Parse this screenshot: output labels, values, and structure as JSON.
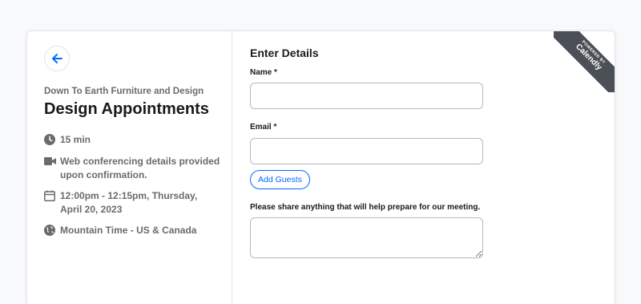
{
  "event": {
    "organization": "Down To Earth Furniture and Design",
    "title": "Design Appointments",
    "duration": "15 min",
    "conferencing": "Web conferencing details provided upon confirmation.",
    "datetime": "12:00pm - 12:15pm, Thursday, April 20, 2023",
    "timezone": "Mountain Time - US & Canada"
  },
  "form": {
    "title": "Enter Details",
    "name_label": "Name *",
    "name_value": "",
    "email_label": "Email *",
    "email_value": "",
    "add_guests_label": "Add Guests",
    "notes_label": "Please share anything that will help prepare for our meeting.",
    "notes_value": ""
  },
  "badge": {
    "powered_by": "POWERED BY",
    "brand": "Calendly"
  },
  "icons": {
    "back": "arrow-left-icon",
    "duration": "clock-icon",
    "conferencing": "video-camera-icon",
    "datetime": "calendar-icon",
    "timezone": "globe-icon"
  },
  "colors": {
    "accent": "#006bff",
    "muted_text": "#6b6b6b",
    "ribbon": "#4b4f56"
  }
}
